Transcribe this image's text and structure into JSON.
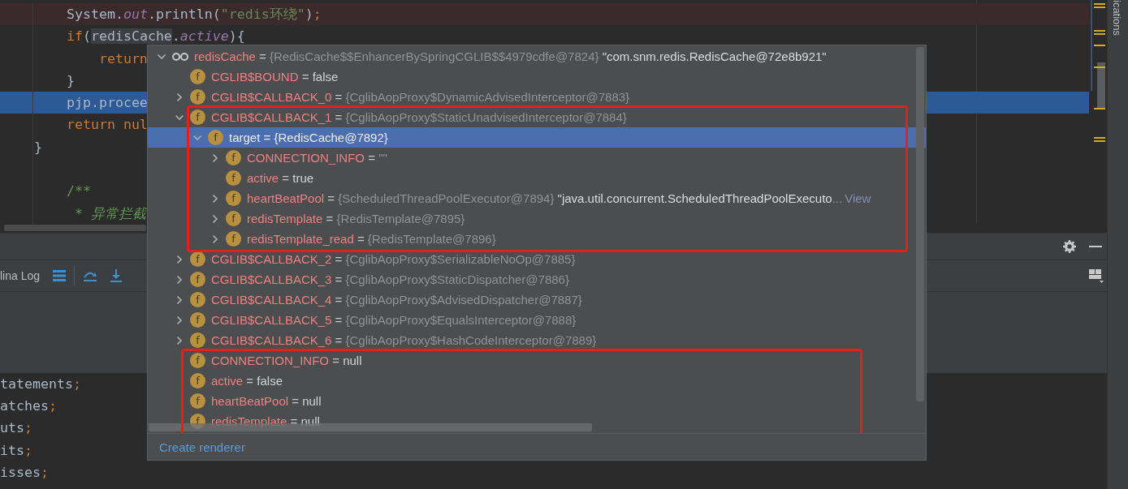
{
  "editor": {
    "lines": [
      {
        "kind": "breakpoint",
        "tokens": [
          {
            "kind": "plain",
            "text": "    System."
          },
          {
            "kind": "field",
            "text": "out"
          },
          {
            "kind": "plain",
            "text": ".println("
          },
          {
            "kind": "string",
            "text": "\"redis环绕\""
          },
          {
            "kind": "plain",
            "text": ")"
          },
          {
            "kind": "punct",
            "text": ";"
          }
        ]
      },
      {
        "kind": "plain",
        "tokens": [
          {
            "kind": "keyword",
            "text": "    if"
          },
          {
            "kind": "plain",
            "text": "("
          },
          {
            "kind": "usage",
            "text": "redisCache"
          },
          {
            "kind": "plain",
            "text": "."
          },
          {
            "kind": "field",
            "text": "active"
          },
          {
            "kind": "plain",
            "text": "){"
          }
        ]
      },
      {
        "kind": "plain",
        "tokens": [
          {
            "kind": "keyword",
            "text": "        return"
          }
        ]
      },
      {
        "kind": "plain",
        "tokens": [
          {
            "kind": "plain",
            "text": "    }"
          }
        ]
      },
      {
        "kind": "execution",
        "tokens": [
          {
            "kind": "plain",
            "text": "    pjp.procee"
          }
        ]
      },
      {
        "kind": "plain",
        "tokens": [
          {
            "kind": "keyword",
            "text": "    return nul"
          }
        ]
      },
      {
        "kind": "plain",
        "tokens": [
          {
            "kind": "plain",
            "text": "}"
          }
        ]
      },
      {
        "kind": "plain"
      },
      {
        "kind": "plain",
        "tokens": [
          {
            "kind": "doc",
            "text": "    /**"
          }
        ]
      },
      {
        "kind": "plain",
        "tokens": [
          {
            "kind": "doc-italic",
            "text": "     * 异常拦截"
          }
        ]
      }
    ]
  },
  "tool_window": {
    "tab": "lina Log"
  },
  "lower_editor": {
    "lines": [
      {
        "tokens": [
          {
            "kind": "plain",
            "text": "tatements"
          },
          {
            "kind": "punct",
            "text": ";"
          }
        ]
      },
      {
        "tokens": [
          {
            "kind": "plain",
            "text": "atches"
          },
          {
            "kind": "punct",
            "text": ";"
          }
        ]
      },
      {
        "tokens": [
          {
            "kind": "plain",
            "text": "uts"
          },
          {
            "kind": "punct",
            "text": ";"
          }
        ]
      },
      {
        "tokens": [
          {
            "kind": "plain",
            "text": "its"
          },
          {
            "kind": "punct",
            "text": ";"
          }
        ]
      },
      {
        "tokens": [
          {
            "kind": "plain",
            "text": "isses"
          },
          {
            "kind": "punct",
            "text": ";"
          }
        ]
      }
    ]
  },
  "side_strip": {
    "label": "ications"
  },
  "popup": {
    "tree": {
      "kind": "watch",
      "name": "redisCache",
      "operator": "=",
      "reference": "{RedisCache$$EnhancerBySpringCGLIB$$4979cdfe@7824}",
      "detail": "\"com.snm.redis.RedisCache@72e8b921\"",
      "expanded": true,
      "selected": false,
      "children": [
        {
          "kind": "field",
          "icon_text": "f",
          "name": "CGLIB$BOUND",
          "operator": "=",
          "value": "false",
          "selected": false
        },
        {
          "kind": "field",
          "icon_text": "f",
          "name": "CGLIB$CALLBACK_0",
          "operator": "=",
          "reference": "{CglibAopProxy$DynamicAdvisedInterceptor@7883}",
          "expanded": false,
          "selected": false
        },
        {
          "kind": "field",
          "icon_text": "f",
          "name": "CGLIB$CALLBACK_1",
          "operator": "=",
          "reference": "{CglibAopProxy$StaticUnadvisedInterceptor@7884}",
          "expanded": true,
          "selected": false,
          "children": [
            {
              "kind": "field",
              "icon_text": "f",
              "name": "target",
              "operator": "=",
              "reference": "{RedisCache@7892}",
              "expanded": true,
              "selected": true,
              "children": [
                {
                  "kind": "field",
                  "icon_text": "f",
                  "name": "CONNECTION_INFO",
                  "operator": "=",
                  "reference": "\"\"",
                  "expanded": false,
                  "selected": false
                },
                {
                  "kind": "field",
                  "icon_text": "f",
                  "name": "active",
                  "operator": "=",
                  "value": "true",
                  "selected": false
                },
                {
                  "kind": "field",
                  "icon_text": "f",
                  "name": "heartBeatPool",
                  "operator": "=",
                  "reference": "{ScheduledThreadPoolExecutor@7894}",
                  "detail": "\"java.util.concurrent.ScheduledThreadPoolExecuto",
                  "ellipsis": "...",
                  "link": "View",
                  "expanded": false,
                  "selected": false
                },
                {
                  "kind": "field",
                  "icon_text": "f",
                  "name": "redisTemplate",
                  "operator": "=",
                  "reference": "{RedisTemplate@7895}",
                  "expanded": false,
                  "selected": false
                },
                {
                  "kind": "field",
                  "icon_text": "f",
                  "name": "redisTemplate_read",
                  "operator": "=",
                  "reference": "{RedisTemplate@7896}",
                  "expanded": false,
                  "selected": false
                }
              ]
            }
          ]
        },
        {
          "kind": "field",
          "icon_text": "f",
          "name": "CGLIB$CALLBACK_2",
          "operator": "=",
          "reference": "{CglibAopProxy$SerializableNoOp@7885}",
          "expanded": false,
          "selected": false
        },
        {
          "kind": "field",
          "icon_text": "f",
          "name": "CGLIB$CALLBACK_3",
          "operator": "=",
          "reference": "{CglibAopProxy$StaticDispatcher@7886}",
          "expanded": false,
          "selected": false
        },
        {
          "kind": "field",
          "icon_text": "f",
          "name": "CGLIB$CALLBACK_4",
          "operator": "=",
          "reference": "{CglibAopProxy$AdvisedDispatcher@7887}",
          "expanded": false,
          "selected": false
        },
        {
          "kind": "field",
          "icon_text": "f",
          "name": "CGLIB$CALLBACK_5",
          "operator": "=",
          "reference": "{CglibAopProxy$EqualsInterceptor@7888}",
          "expanded": false,
          "selected": false
        },
        {
          "kind": "field",
          "icon_text": "f",
          "name": "CGLIB$CALLBACK_6",
          "operator": "=",
          "reference": "{CglibAopProxy$HashCodeInterceptor@7889}",
          "expanded": false,
          "selected": false
        },
        {
          "kind": "field",
          "icon_text": "f",
          "name": "CONNECTION_INFO",
          "operator": "=",
          "value": "null",
          "selected": false
        },
        {
          "kind": "field",
          "icon_text": "f",
          "name": "active",
          "operator": "=",
          "value": "false",
          "selected": false
        },
        {
          "kind": "field",
          "icon_text": "f",
          "name": "heartBeatPool",
          "operator": "=",
          "value": "null",
          "selected": false
        },
        {
          "kind": "field",
          "icon_text": "f",
          "name": "redisTemplate",
          "operator": "=",
          "value": "null",
          "selected": false
        }
      ]
    },
    "annotations": [
      {
        "kind": "rectangle"
      },
      {
        "kind": "rectangle"
      }
    ],
    "footer_link": "Create renderer"
  }
}
